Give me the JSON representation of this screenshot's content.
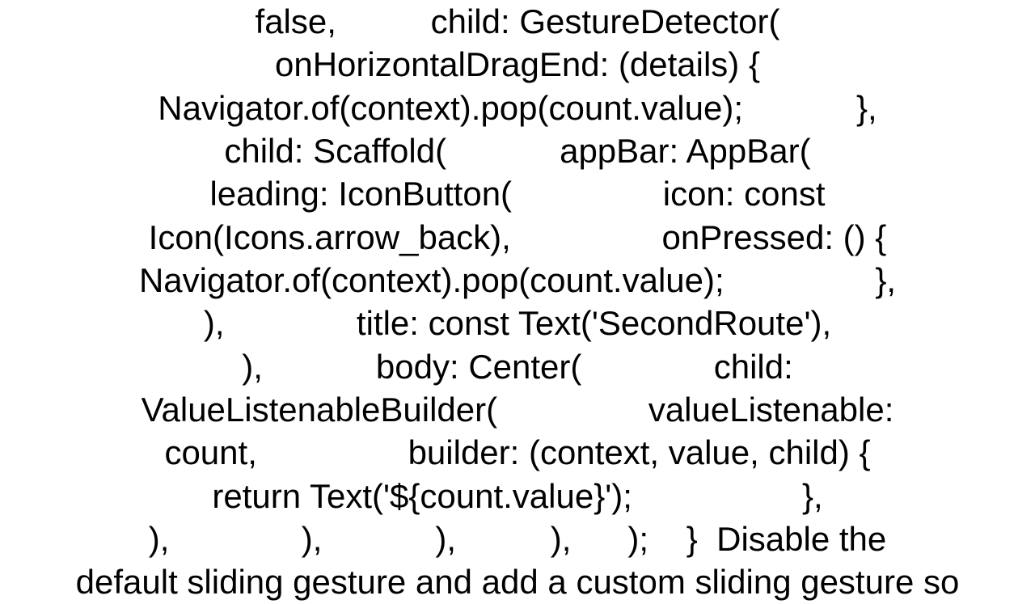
{
  "lines": [
    "false,          child: GestureDetector(",
    "onHorizontalDragEnd: (details) {",
    "Navigator.of(context).pop(count.value);            },",
    "child: Scaffold(            appBar: AppBar(",
    "leading: IconButton(                icon: const",
    "Icon(Icons.arrow_back),                onPressed: () {",
    "Navigator.of(context).pop(count.value);                },",
    "),              title: const Text('SecondRoute'),",
    "),            body: Center(              child:",
    "ValueListenableBuilder(                valueListenable:",
    "count,                builder: (context, value, child) {",
    "return Text('${count.value}');                  },",
    "),              ),            ),          ),      );    }  Disable the",
    "default sliding gesture and add a custom sliding gesture so"
  ]
}
